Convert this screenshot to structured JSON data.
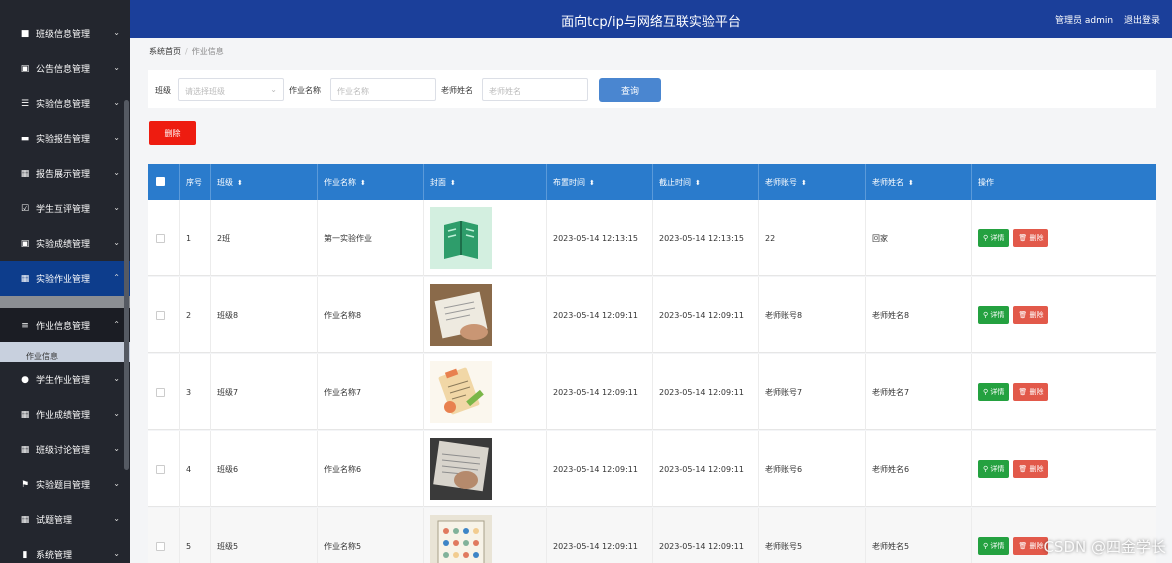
{
  "header": {
    "title": "面向tcp/ip与网络互联实验平台",
    "user": "管理员 admin",
    "logout": "退出登录"
  },
  "sidebar": {
    "items": [
      {
        "label": "班级信息管理",
        "icon": "briefcase-icon"
      },
      {
        "label": "公告信息管理",
        "icon": "clipboard-icon"
      },
      {
        "label": "实验信息管理",
        "icon": "list-icon"
      },
      {
        "label": "实验报告管理",
        "icon": "monitor-icon"
      },
      {
        "label": "报告展示管理",
        "icon": "grid-icon"
      },
      {
        "label": "学生互评管理",
        "icon": "check-square-icon"
      },
      {
        "label": "实验成绩管理",
        "icon": "clipboard-icon"
      },
      {
        "label": "实验作业管理",
        "icon": "grid-icon"
      },
      {
        "label": "作业信息管理",
        "icon": "sliders-icon"
      },
      {
        "label": "学生作业管理",
        "icon": "user-icon"
      },
      {
        "label": "作业成绩管理",
        "icon": "grid-icon"
      },
      {
        "label": "班级讨论管理",
        "icon": "grid-icon"
      },
      {
        "label": "实验题目管理",
        "icon": "flag-icon"
      },
      {
        "label": "试题管理",
        "icon": "grid-icon"
      },
      {
        "label": "系统管理",
        "icon": "bar-chart-icon"
      }
    ],
    "subitem": "作业信息"
  },
  "breadcrumb": {
    "home": "系统首页",
    "current": "作业信息"
  },
  "search": {
    "class_label": "班级",
    "class_placeholder": "请选择班级",
    "name_label": "作业名称",
    "name_placeholder": "作业名称",
    "teacher_label": "老师姓名",
    "teacher_placeholder": "老师姓名",
    "query": "查询"
  },
  "delete_label": "删除",
  "table": {
    "headers": [
      "序号",
      "班级",
      "作业名称",
      "封面",
      "布置时间",
      "截止时间",
      "老师账号",
      "老师姓名",
      "操作"
    ],
    "detail_label": "详情",
    "delete_label": "删除",
    "rows": [
      {
        "no": "1",
        "class": "2班",
        "name": "第一实验作业",
        "publish": "2023-05-14 12:13:15",
        "deadline": "2023-05-14 12:13:15",
        "account": "22",
        "teacher": "回家"
      },
      {
        "no": "2",
        "class": "班级8",
        "name": "作业名称8",
        "publish": "2023-05-14 12:09:11",
        "deadline": "2023-05-14 12:09:11",
        "account": "老师账号8",
        "teacher": "老师姓名8"
      },
      {
        "no": "3",
        "class": "班级7",
        "name": "作业名称7",
        "publish": "2023-05-14 12:09:11",
        "deadline": "2023-05-14 12:09:11",
        "account": "老师账号7",
        "teacher": "老师姓名7"
      },
      {
        "no": "4",
        "class": "班级6",
        "name": "作业名称6",
        "publish": "2023-05-14 12:09:11",
        "deadline": "2023-05-14 12:09:11",
        "account": "老师账号6",
        "teacher": "老师姓名6"
      },
      {
        "no": "5",
        "class": "班级5",
        "name": "作业名称5",
        "publish": "2023-05-14 12:09:11",
        "deadline": "2023-05-14 12:09:11",
        "account": "老师账号5",
        "teacher": "老师姓名5"
      }
    ]
  },
  "watermark": "CSDN @四金学长"
}
